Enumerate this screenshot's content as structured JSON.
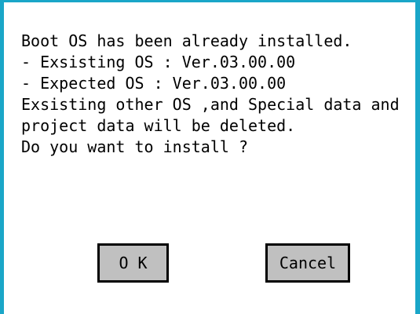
{
  "dialog": {
    "message_lines": [
      "Boot OS has been already installed.",
      "- Exsisting OS : Ver.03.00.00",
      "- Expected OS : Ver.03.00.00",
      "Exsisting other OS ,and Special data and",
      "project data will be deleted.",
      "Do you want to install ?"
    ],
    "ok_label": "O K",
    "cancel_label": "Cancel"
  },
  "colors": {
    "frame": "#1aa6c8",
    "button_face": "#c0c0c0",
    "background": "#ffffff"
  }
}
